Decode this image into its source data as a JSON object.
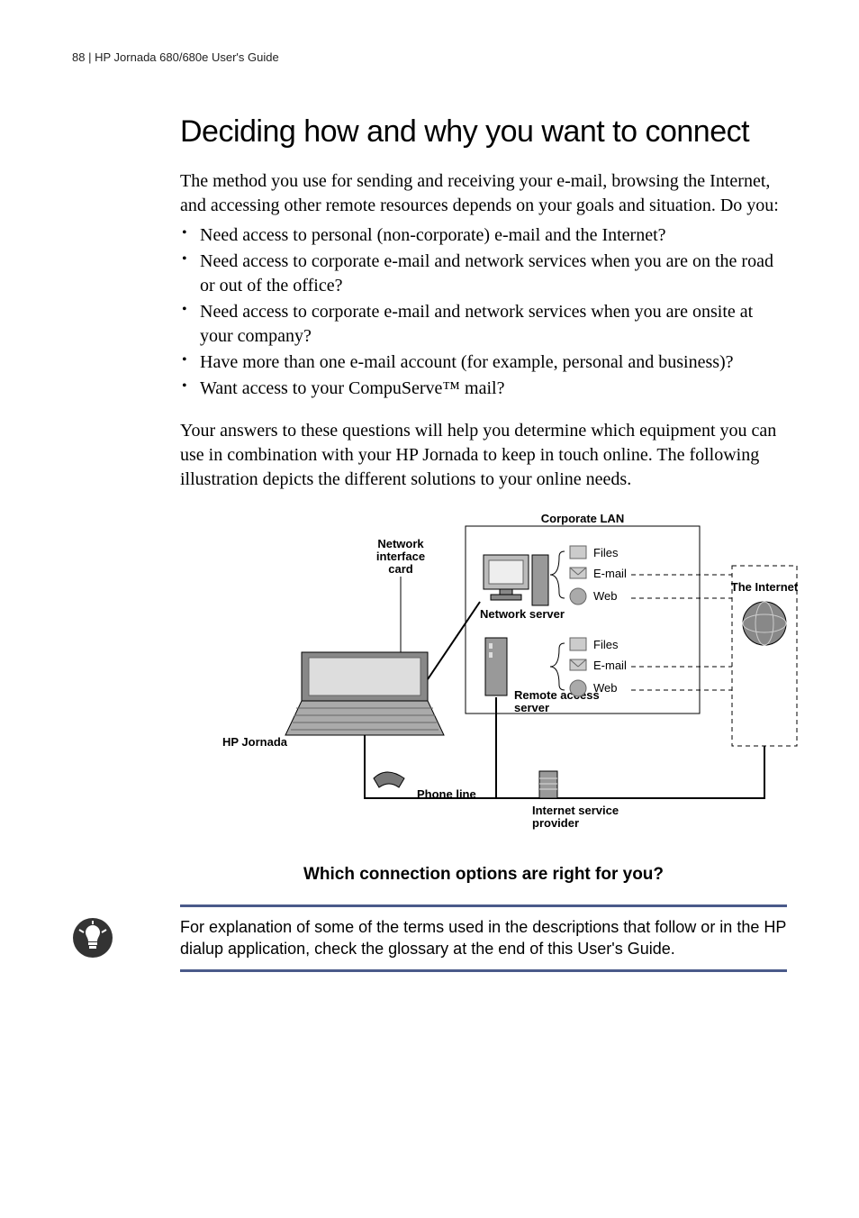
{
  "header": {
    "page_number": "88",
    "separator": "|",
    "doc_title": "HP Jornada 680/680e User's Guide"
  },
  "section": {
    "heading": "Deciding how and why you want to connect",
    "intro": "The method you use for sending and receiving your e-mail, browsing the Internet, and accessing other remote resources depends on your goals and situation. Do you:",
    "bullets": [
      "Need access to personal (non-corporate) e-mail and the Internet?",
      "Need access to corporate e-mail and network services when you are on the road or out of the office?",
      "Need access to corporate e-mail and network services when you are onsite at your company?",
      "Have more than one e-mail account (for example, personal and business)?",
      "Want access to your CompuServe™ mail?"
    ],
    "outro": "Your answers to these questions will help you determine which equipment you can use in combination with your HP Jornada to keep in touch online. The following illustration depicts the different solutions to your online needs."
  },
  "figure": {
    "caption": "Which connection options are right for you?",
    "labels": {
      "corporate_lan": "Corporate LAN",
      "nic_line1": "Network",
      "nic_line2": "interface",
      "nic_line3": "card",
      "files": "Files",
      "email": "E-mail",
      "web": "Web",
      "network_server": "Network server",
      "ras_line1": "Remote access",
      "ras_line2": "server",
      "hp_jornada": "HP Jornada",
      "phone_line": "Phone line",
      "isp_line1": "Internet service",
      "isp_line2": "provider",
      "the_internet": "The Internet"
    }
  },
  "note": {
    "text": "For explanation of some of the terms used in the descriptions that follow or in the HP dialup application, check the glossary at the end of this User's Guide."
  }
}
